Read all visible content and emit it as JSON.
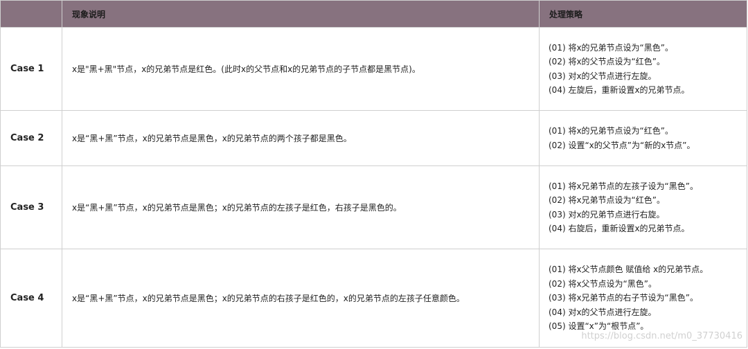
{
  "header": {
    "col_case": "",
    "col_desc": "现象说明",
    "col_steps": "处理策略"
  },
  "rows": [
    {
      "name": "Case 1",
      "desc": "x是\"黑+黑\"节点，x的兄弟节点是红色。(此时x的父节点和x的兄弟节点的子节点都是黑节点)。",
      "steps": [
        "(01) 将x的兄弟节点设为“黑色”。",
        "(02) 将x的父节点设为“红色”。",
        "(03) 对x的父节点进行左旋。",
        "(04) 左旋后，重新设置x的兄弟节点。"
      ]
    },
    {
      "name": "Case 2",
      "desc": "x是“黑+黑”节点，x的兄弟节点是黑色，x的兄弟节点的两个孩子都是黑色。",
      "steps": [
        "(01) 将x的兄弟节点设为“红色”。",
        "(02) 设置“x的父节点”为“新的x节点”。"
      ]
    },
    {
      "name": "Case 3",
      "desc": "x是“黑+黑”节点，x的兄弟节点是黑色；x的兄弟节点的左孩子是红色，右孩子是黑色的。",
      "steps": [
        "(01) 将x兄弟节点的左孩子设为“黑色”。",
        "(02) 将x兄弟节点设为“红色”。",
        "(03) 对x的兄弟节点进行右旋。",
        "(04) 右旋后，重新设置x的兄弟节点。"
      ]
    },
    {
      "name": "Case 4",
      "desc": "x是“黑+黑”节点，x的兄弟节点是黑色；x的兄弟节点的右孩子是红色的，x的兄弟节点的左孩子任意颜色。",
      "steps": [
        "(01) 将x父节点颜色 赋值给 x的兄弟节点。",
        "(02) 将x父节点设为“黑色”。",
        "(03) 将x兄弟节点的右子节设为“黑色”。",
        "(04) 对x的父节点进行左旋。",
        "(05) 设置“x”为“根节点”。"
      ]
    }
  ],
  "watermark": "https://blog.csdn.net/m0_37730416",
  "colors": {
    "header_bg": "#87727f",
    "border": "#cfcfcf"
  }
}
